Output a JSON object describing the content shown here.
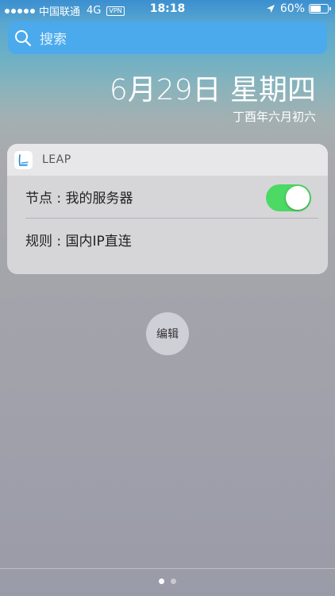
{
  "status_bar": {
    "carrier": "中国联通",
    "network": "4G",
    "vpn": "VPN",
    "time": "18:18",
    "battery_percent": "60%",
    "battery_level": 0.6,
    "icons": [
      "signal-dots-icon",
      "vpn-badge-icon",
      "location-arrow-icon",
      "battery-icon"
    ]
  },
  "search": {
    "placeholder": "搜索",
    "icon": "search-icon"
  },
  "date": {
    "main": "6月29日 星期四",
    "lunar": "丁酉年六月初六"
  },
  "widget": {
    "app_name": "LEAP",
    "app_icon": "leap-app-icon",
    "rows": [
      {
        "label": "节点 : 我的服务器",
        "toggle": true
      },
      {
        "label": "规则 : 国内IP直连"
      }
    ],
    "colors": {
      "toggle_on": "#4cd964"
    }
  },
  "edit_button": {
    "label": "编辑"
  },
  "pages": {
    "count": 2,
    "active": 0
  }
}
